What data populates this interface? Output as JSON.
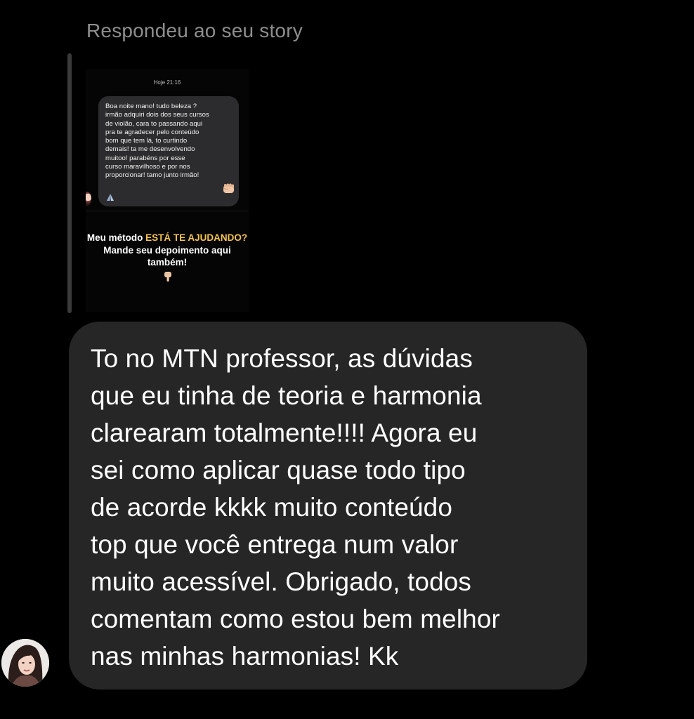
{
  "thread": {
    "reply_header": "Respondeu ao seu story"
  },
  "story": {
    "timestamp": "Hoje 21:16",
    "bubble_text": "Boa noite mano! tudo beleza ?\nirmão adquiri dois dos seus cursos\nde violão, cara to passando aqui\npra te agradecer pelo conteúdo\nbom que tem lá, to curtindo\ndemais! ta me desenvolvendo\nmuitoo! parabéns por esse\ncurso maravilhoso e por nos\nproporcionar! tamo junto irmão!",
    "cta_part1": "Meu método ",
    "cta_highlight": "ESTÁ TE AJUDANDO?",
    "cta_part2": " Mande seu depoimento aqui também!",
    "cta_highlight_color": "#f5c451",
    "icons": [
      "fist-emoji-icon",
      "praying-hands-emoji-icon",
      "point-down-emoji-icon"
    ]
  },
  "message": {
    "text": "To no MTN professor, as dúvidas\nque eu tinha de teoria e harmonia\nclarearam totalmente!!!! Agora eu\nsei como aplicar quase todo tipo\nde acorde kkkk muito conteúdo\ntop que você entrega num valor\nmuito acessível. Obrigado, todos\ncomentam como estou bem melhor\nnas minhas harmonias! Kk",
    "bubble_color": "#262626"
  },
  "sender": {
    "avatar_icon": "avatar"
  }
}
